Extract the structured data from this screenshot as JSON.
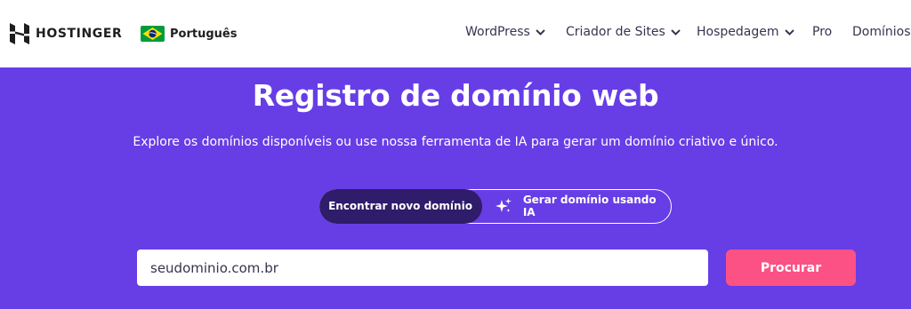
{
  "header": {
    "logo_text": "HOSTINGER",
    "language": {
      "label": "Português",
      "flag_icon": "brazil-flag-icon"
    },
    "nav": [
      {
        "label": "WordPress",
        "has_dropdown": true
      },
      {
        "label": "Criador de Sites",
        "has_dropdown": true
      },
      {
        "label": "Hospedagem",
        "has_dropdown": true
      },
      {
        "label": "Pro",
        "has_dropdown": false
      },
      {
        "label": "Domínios",
        "has_dropdown": false
      }
    ]
  },
  "hero": {
    "title": "Registro de domínio web",
    "subtitle": "Explore os domínios disponíveis ou use nossa ferramenta de IA para gerar um domínio criativo e único.",
    "tabs": [
      {
        "label": "Encontrar novo domínio",
        "active": true
      },
      {
        "label": "Gerar domínio usando IA",
        "active": false,
        "icon": "sparkle-icon"
      }
    ],
    "search": {
      "placeholder": "seudominio.com.br",
      "value": ""
    },
    "button_label": "Procurar"
  },
  "colors": {
    "brand_purple": "#673de6",
    "dark_purple": "#2f1c6a",
    "cta_pink": "#fc5185"
  }
}
